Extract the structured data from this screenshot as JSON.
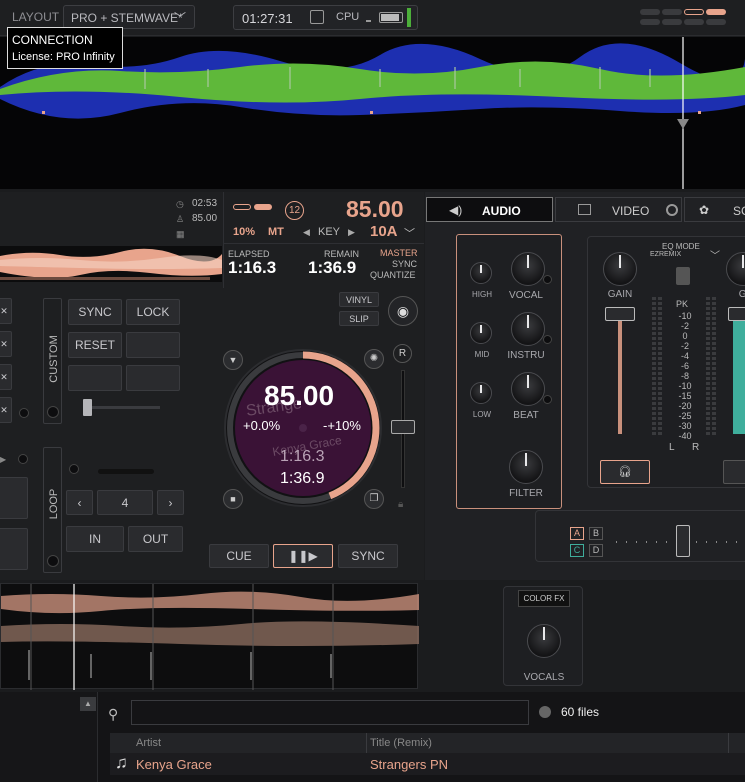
{
  "topbar": {
    "layout_label": "LAYOUT",
    "layout_value": "PRO + STEMWAVE*",
    "clock": "01:27:31",
    "cpu_label": "CPU",
    "cpu_meter": 0.9
  },
  "connection": {
    "title": "CONNECTION",
    "license": "License: PRO Infinity"
  },
  "deck": {
    "time1": "02:53",
    "bpm_small": "85.00",
    "bpm_large": "85.00",
    "pitch_range": "10%",
    "mt": "MT",
    "key_label": "KEY",
    "key_value": "10A",
    "badge": "12",
    "elapsed_label": "ELAPSED",
    "elapsed": "1:16.3",
    "remain_label": "REMAIN",
    "remain": "1:36.9",
    "master": "MASTER",
    "sync": "SYNC",
    "quantize": "QUANTIZE",
    "vinyl": "VINYL",
    "slip": "SLIP",
    "r_label": "R"
  },
  "platter": {
    "bpm": "85.00",
    "pitch": "+0.0%",
    "range": "-+10%",
    "elapsed": "1:16.3",
    "remain": "1:36.9",
    "title_ghost": "Strange",
    "artist_ghost": "Kenya Grace",
    "progress": 0.44
  },
  "pads": {
    "custom_label": "CUSTOM",
    "loop_label": "LOOP",
    "sync": "SYNC",
    "lock": "LOCK",
    "reset": "RESET",
    "loop_size": "4",
    "prev": "‹",
    "next": "›",
    "in": "IN",
    "out": "OUT"
  },
  "transport": {
    "cue": "CUE",
    "play": "❚❚▶",
    "sync": "SYNC"
  },
  "tabs": {
    "audio": "AUDIO",
    "video": "VIDEO",
    "third": "SC"
  },
  "stems": {
    "high": "HIGH",
    "mid": "MID",
    "low": "LOW",
    "vocal": "VOCAL",
    "instru": "INSTRU",
    "beat": "BEAT",
    "filter": "FILTER"
  },
  "mixer": {
    "eq_mode": "EQ MODE",
    "eq_value": "EZREMIX",
    "gain": "GAIN",
    "gain2": "GA",
    "pk": "PK",
    "scale": [
      "-10",
      "-2",
      "0",
      "-2",
      "-4",
      "-6",
      "-8",
      "-10",
      "-15",
      "-20",
      "-25",
      "-30",
      "-40"
    ],
    "l": "L",
    "r": "R"
  },
  "crossfader": {
    "a": "A",
    "b": "B",
    "c": "C",
    "d": "D"
  },
  "colorfx": {
    "label": "COLOR FX",
    "knob": "VOCALS"
  },
  "browser": {
    "search_placeholder": "",
    "files": "60 files",
    "col_artist": "Artist",
    "col_title": "Title (Remix)",
    "row_artist": "Kenya Grace",
    "row_title": "Strangers PN"
  },
  "colors": {
    "accent": "#e8a48c",
    "green": "#5fb83a",
    "blue": "#1d2fb0",
    "purple": "#3a1236",
    "teal": "#3fae9c"
  }
}
